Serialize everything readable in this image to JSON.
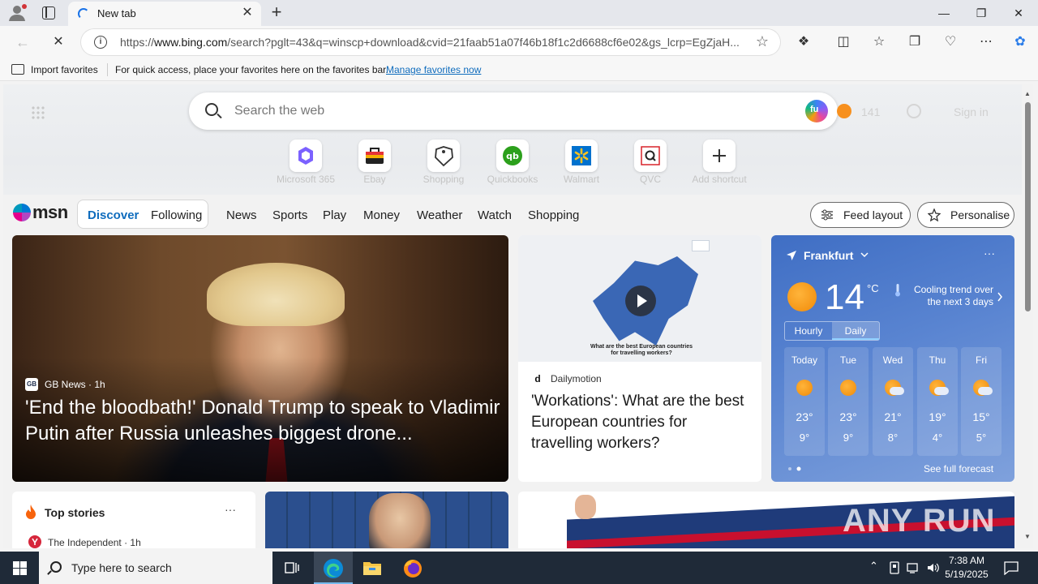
{
  "browser": {
    "tab_title": "New tab",
    "url_prefix": "https://",
    "url_host": "www.bing.com",
    "url_rest": "/search?pglt=43&q=winscp+download&cvid=21faab51a07f46b18f1c2d6688cf6e02&gs_lcrp=EgZjaH...",
    "new_tab_symbol": "+",
    "close_symbol": "✕"
  },
  "favorites_bar": {
    "import_label": "Import favorites",
    "message": "For quick access, place your favorites here on the favorites bar.",
    "manage_link": "Manage favorites now"
  },
  "bing": {
    "search_placeholder": "Search the web",
    "rewards_points": "141",
    "signin_label": "Sign in",
    "shortcuts": [
      {
        "label": "Microsoft 365",
        "icon": "microsoft365-icon",
        "color": "#7b61ff"
      },
      {
        "label": "Ebay",
        "icon": "ebay-icon",
        "color": "#e53238"
      },
      {
        "label": "Shopping",
        "icon": "shopping-tag-icon",
        "color": "#333333"
      },
      {
        "label": "Quickbooks",
        "icon": "quickbooks-icon",
        "color": "#2ca01c"
      },
      {
        "label": "Walmart",
        "icon": "walmart-icon",
        "color": "#0071ce"
      },
      {
        "label": "QVC",
        "icon": "qvc-icon",
        "color": "#d8232a"
      },
      {
        "label": "Add shortcut",
        "icon": "plus-icon",
        "color": "#333333"
      }
    ]
  },
  "msn": {
    "logo_text": "msn",
    "segment": {
      "discover": "Discover",
      "following": "Following"
    },
    "nav_links": [
      "News",
      "Sports",
      "Play",
      "Money",
      "Weather",
      "Watch",
      "Shopping"
    ],
    "feed_layout_label": "Feed layout",
    "personalise_label": "Personalise"
  },
  "cards": {
    "lead": {
      "source_badge": "GB",
      "source": "GB News · 1h",
      "title": "'End the bloodbath!' Donald Trump to speak to Vladimir Putin after Russia unleashes biggest drone..."
    },
    "video": {
      "source_badge": "d",
      "source": "Dailymotion",
      "caption": "What are the best European countries for travelling workers?",
      "title": "'Workations': What are the best European countries for travelling workers?"
    }
  },
  "weather": {
    "location": "Frankfurt",
    "temperature": "14",
    "unit": "°C",
    "trend": "Cooling trend over the next 3 days",
    "tabs": [
      "Hourly",
      "Daily"
    ],
    "active_tab": "Daily",
    "days": [
      {
        "name": "Today",
        "high": "23°",
        "low": "9°",
        "icon": "sunny"
      },
      {
        "name": "Tue",
        "high": "23°",
        "low": "9°",
        "icon": "sunny"
      },
      {
        "name": "Wed",
        "high": "21°",
        "low": "8°",
        "icon": "partly-cloudy"
      },
      {
        "name": "Thu",
        "high": "19°",
        "low": "4°",
        "icon": "partly-cloudy"
      },
      {
        "name": "Fri",
        "high": "15°",
        "low": "5°",
        "icon": "partly-cloudy"
      }
    ],
    "see_full_label": "See full forecast",
    "more_symbol": "···"
  },
  "top_stories": {
    "title": "Top stories",
    "first_source": "The Independent · 1h",
    "more_symbol": "···"
  },
  "watermark": "ANY RUN",
  "taskbar": {
    "search_placeholder": "Type here to search",
    "time": "7:38 AM",
    "date": "5/19/2025"
  },
  "colors": {
    "accent": "#0f6cbd",
    "taskbar": "#1f2a38",
    "weather_card": "#4a77c9"
  }
}
